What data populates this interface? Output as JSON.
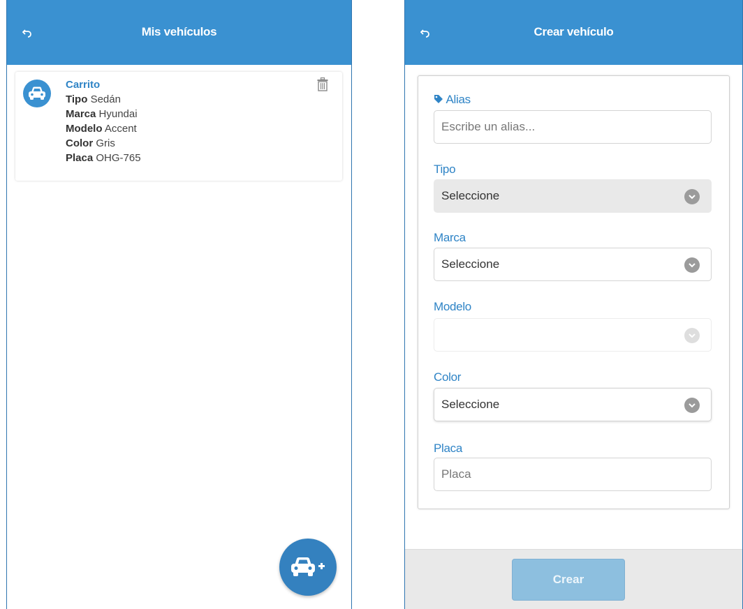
{
  "left": {
    "header": {
      "title": "Mis vehículos"
    },
    "vehicle": {
      "alias": "Carrito",
      "fields": [
        {
          "label": "Tipo",
          "value": "Sedán"
        },
        {
          "label": "Marca",
          "value": "Hyundai"
        },
        {
          "label": "Modelo",
          "value": "Accent"
        },
        {
          "label": "Color",
          "value": "Gris"
        },
        {
          "label": "Placa",
          "value": "OHG-765"
        }
      ]
    }
  },
  "right": {
    "header": {
      "title": "Crear vehículo"
    },
    "form": {
      "alias_label": "Alias",
      "alias_placeholder": "Escribe un alias...",
      "tipo_label": "Tipo",
      "tipo_value": "Seleccione",
      "marca_label": "Marca",
      "marca_value": "Seleccione",
      "modelo_label": "Modelo",
      "modelo_value": "",
      "color_label": "Color",
      "color_value": "Seleccione",
      "placa_label": "Placa",
      "placa_placeholder": "Placa"
    },
    "submit_label": "Crear"
  },
  "colors": {
    "header": "#3a91d1",
    "accent": "#2f84c6",
    "fab": "#3481bf",
    "button_disabled": "#8dbfdf"
  },
  "icons": [
    "back-icon",
    "car-icon",
    "trash-icon",
    "add-car-icon",
    "tag-icon",
    "chevron-down-icon"
  ]
}
